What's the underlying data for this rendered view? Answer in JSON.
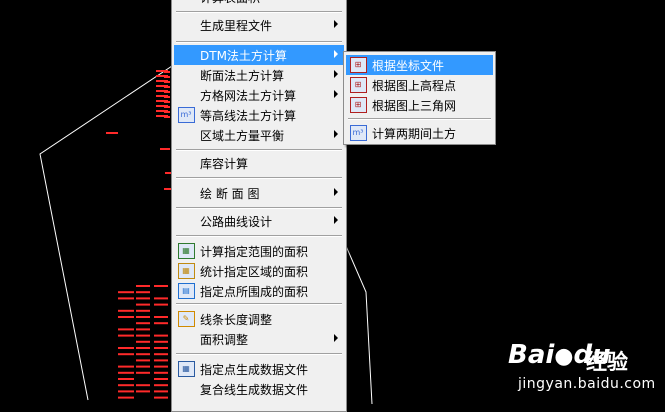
{
  "colors": {
    "background": "#000000",
    "menu_bg": "#f0f0f0",
    "highlight": "#3399ff",
    "drawing_lines": "#ffffff",
    "point_labels": "#ff0000"
  },
  "main_menu": {
    "items": [
      {
        "label": "计算表面积",
        "has_submenu": true,
        "icon": ""
      },
      {
        "label": "生成里程文件",
        "has_submenu": true,
        "icon": ""
      },
      {
        "label": "DTM法土方计算",
        "has_submenu": true,
        "icon": "",
        "highlighted": true
      },
      {
        "label": "断面法土方计算",
        "has_submenu": true,
        "icon": ""
      },
      {
        "label": "方格网法土方计算",
        "has_submenu": true,
        "icon": ""
      },
      {
        "label": "等高线法土方计算",
        "has_submenu": false,
        "icon": "contour-volume-icon"
      },
      {
        "label": "区域土方量平衡",
        "has_submenu": true,
        "icon": ""
      },
      {
        "label": "库容计算",
        "has_submenu": false,
        "icon": ""
      },
      {
        "label": "绘 断 面 图",
        "has_submenu": true,
        "icon": ""
      },
      {
        "label": "公路曲线设计",
        "has_submenu": true,
        "icon": ""
      },
      {
        "label": "计算指定范围的面积",
        "has_submenu": false,
        "icon": "area-range-icon"
      },
      {
        "label": "统计指定区域的面积",
        "has_submenu": false,
        "icon": "area-stat-icon"
      },
      {
        "label": "指定点所围成的面积",
        "has_submenu": false,
        "icon": "point-area-icon"
      },
      {
        "label": "线条长度调整",
        "has_submenu": false,
        "icon": "line-length-icon"
      },
      {
        "label": "面积调整",
        "has_submenu": true,
        "icon": ""
      },
      {
        "label": "指定点生成数据文件",
        "has_submenu": false,
        "icon": "point-data-icon"
      },
      {
        "label": "复合线生成数据文件",
        "has_submenu": false,
        "icon": ""
      }
    ]
  },
  "sub_menu": {
    "items": [
      {
        "label": "根据坐标文件",
        "icon": "coordinate-file-icon",
        "highlighted": true
      },
      {
        "label": "根据图上高程点",
        "icon": "elevation-points-icon"
      },
      {
        "label": "根据图上三角网",
        "icon": "triangle-net-icon"
      },
      {
        "label": "计算两期间土方",
        "icon": "two-period-volume-icon"
      }
    ]
  },
  "watermark": {
    "baidu": "Bai",
    "baidu_suffix": "du",
    "jingyan_cn": "经验",
    "jingyan_url": "jingyan.baidu.com"
  }
}
